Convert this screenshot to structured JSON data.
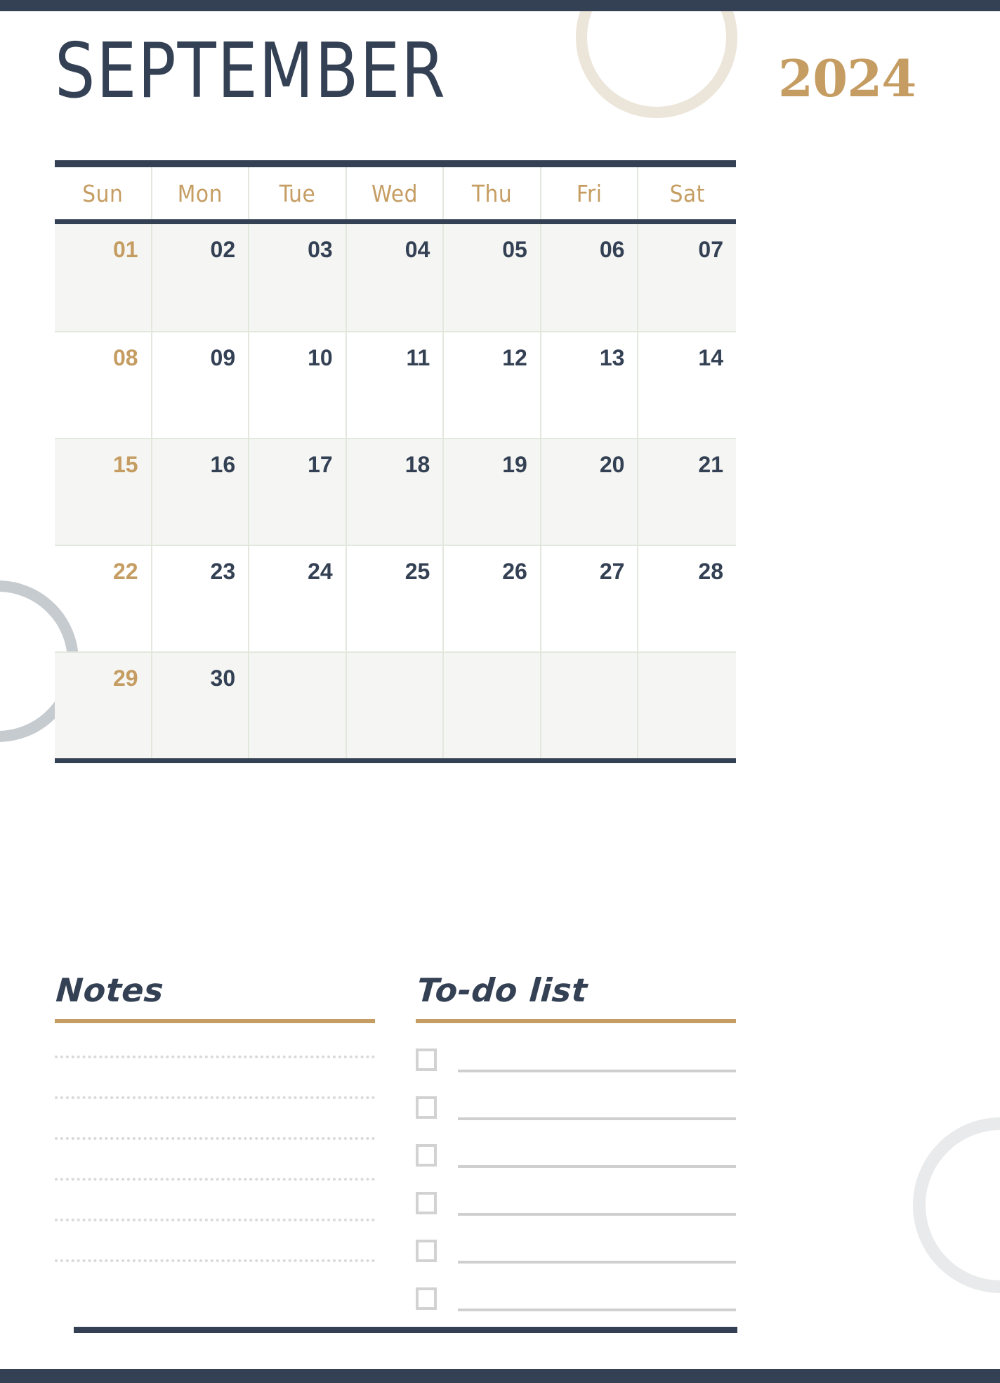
{
  "page": {
    "month": "SEPTEMBER",
    "year": "2024"
  },
  "colors": {
    "navy": "#344154",
    "gold": "#c59d62",
    "sage_grid": "#e2e8dd",
    "row_tint": "#f5f6f3",
    "cream_circle": "#ece5da",
    "gray_circle": "#c6cbd0",
    "light_circle": "#e9eaeb"
  },
  "calendar": {
    "weekdays": [
      "Sun",
      "Mon",
      "Tue",
      "Wed",
      "Thu",
      "Fri",
      "Sat"
    ],
    "weeks": [
      [
        "01",
        "02",
        "03",
        "04",
        "05",
        "06",
        "07"
      ],
      [
        "08",
        "09",
        "10",
        "11",
        "12",
        "13",
        "14"
      ],
      [
        "15",
        "16",
        "17",
        "18",
        "19",
        "20",
        "21"
      ],
      [
        "22",
        "23",
        "24",
        "25",
        "26",
        "27",
        "28"
      ],
      [
        "29",
        "30",
        "",
        "",
        "",
        "",
        ""
      ]
    ]
  },
  "notes": {
    "title": "Notes",
    "line_count": 6
  },
  "todo": {
    "title": "To-do list",
    "item_count": 6
  },
  "icons": {
    "checkbox": "checkbox-empty-icon"
  }
}
